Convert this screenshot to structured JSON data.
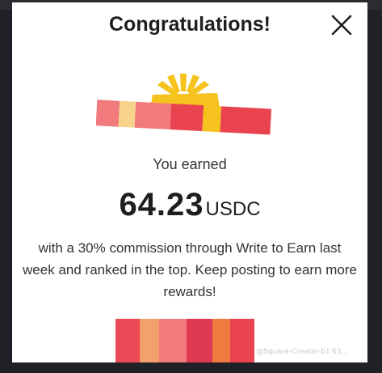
{
  "dialog": {
    "title": "Congratulations!",
    "close_label": "Close",
    "earned_label": "You earned",
    "amount": "64.23",
    "currency": "USDC",
    "description": "with a 30% commission through Write to Earn last week and ranked in the top. Keep posting to earn more rewards!"
  },
  "watermark": "@Square-Creator-b1'63...",
  "icons": {
    "close": "close-icon",
    "gift": "gift-ribbon-icon",
    "giftbox": "gift-box-icon"
  },
  "colors": {
    "ribbon_red": "#e8434e",
    "ribbon_pink": "#f07a7c",
    "ribbon_yellow": "#f6c21d",
    "ribbon_peach": "#f8d38b",
    "text_dark": "#1e1e1e"
  }
}
